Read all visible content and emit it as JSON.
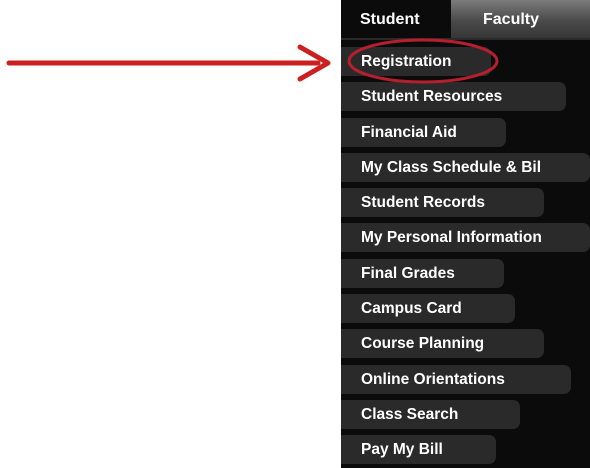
{
  "tabs": [
    {
      "label": "Student",
      "active": true
    },
    {
      "label": "Faculty",
      "active": false
    }
  ],
  "menu": {
    "items": [
      {
        "label": "Registration",
        "highlighted": true
      },
      {
        "label": "Student Resources"
      },
      {
        "label": "Financial Aid"
      },
      {
        "label": "My Class Schedule & Bil"
      },
      {
        "label": "Student Records"
      },
      {
        "label": "My Personal Information"
      },
      {
        "label": "Final Grades"
      },
      {
        "label": "Campus Card"
      },
      {
        "label": "Course Planning"
      },
      {
        "label": "Online Orientations"
      },
      {
        "label": "Class Search"
      },
      {
        "label": "Pay My Bill"
      }
    ]
  },
  "colors": {
    "annotation": "#cc1f1f",
    "menu_background": "#0b0b0b",
    "item_background": "#2a2a2a",
    "text": "#ffffff"
  }
}
